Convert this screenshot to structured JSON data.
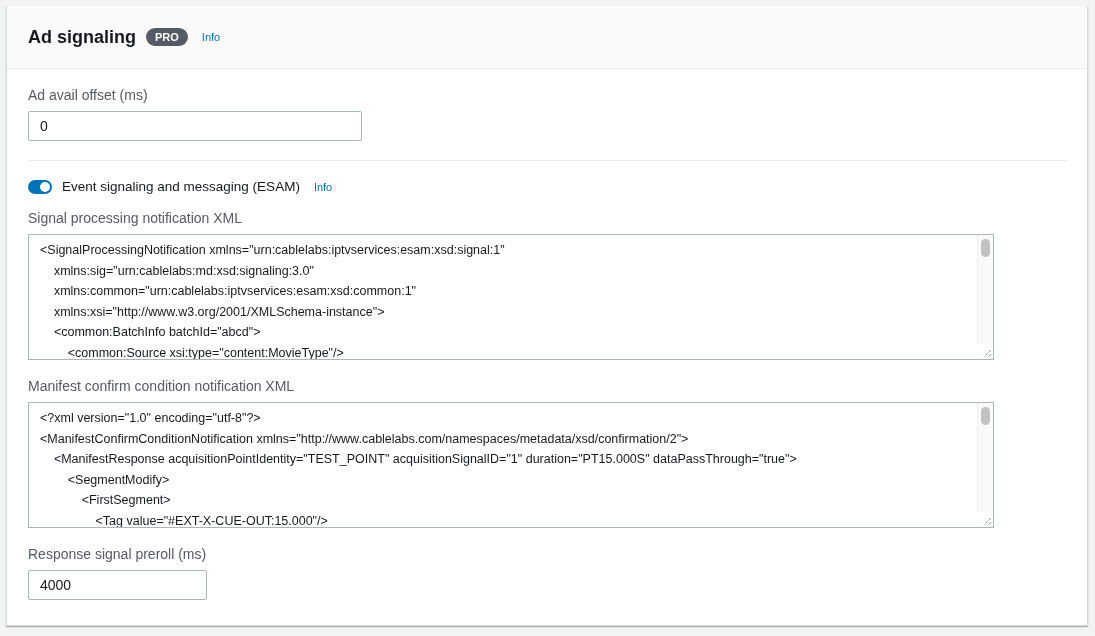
{
  "header": {
    "title": "Ad signaling",
    "badge": "PRO",
    "info": "Info"
  },
  "ad_avail_offset": {
    "label": "Ad avail offset (ms)",
    "value": "0"
  },
  "esam": {
    "label": "Event signaling and messaging (ESAM)",
    "on": true,
    "info": "Info"
  },
  "signal_processing_xml": {
    "label": "Signal processing notification XML",
    "value": "<SignalProcessingNotification xmlns=\"urn:cablelabs:iptvservices:esam:xsd:signal:1\"\n    xmlns:sig=\"urn:cablelabs:md:xsd:signaling:3.0\"\n    xmlns:common=\"urn:cablelabs:iptvservices:esam:xsd:common:1\"\n    xmlns:xsi=\"http://www.w3.org/2001/XMLSchema-instance\">\n    <common:BatchInfo batchId=\"abcd\">\n        <common:Source xsi:type=\"content:MovieType\"/>"
  },
  "manifest_confirm_xml": {
    "label": "Manifest confirm condition notification XML",
    "value": "<?xml version=\"1.0\" encoding=\"utf-8\"?>\n<ManifestConfirmConditionNotification xmlns=\"http://www.cablelabs.com/namespaces/metadata/xsd/confirmation/2\">\n    <ManifestResponse acquisitionPointIdentity=\"TEST_POINT\" acquisitionSignalID=\"1\" duration=\"PT15.000S\" dataPassThrough=\"true\">\n        <SegmentModify>\n            <FirstSegment>\n                <Tag value=\"#EXT-X-CUE-OUT:15.000\"/>"
  },
  "response_signal_preroll": {
    "label": "Response signal preroll (ms)",
    "value": "4000"
  }
}
